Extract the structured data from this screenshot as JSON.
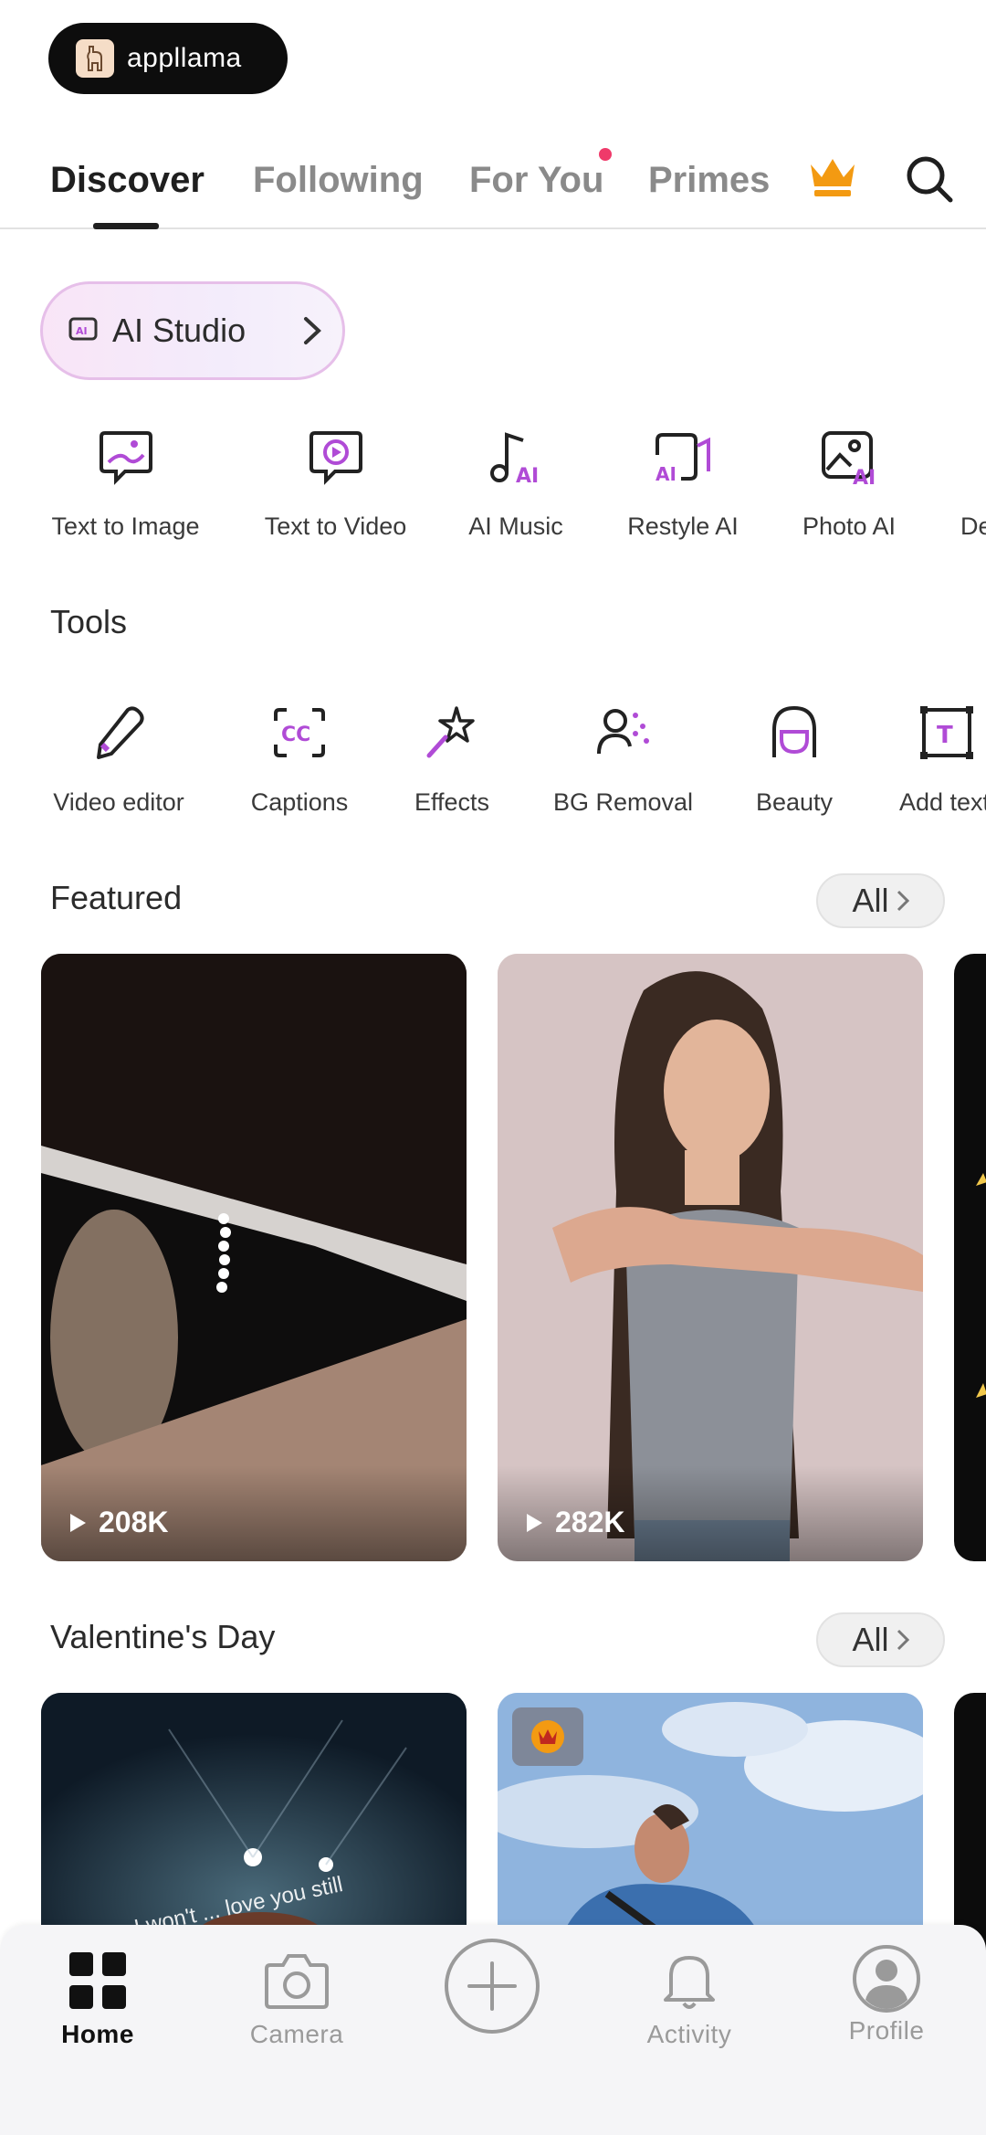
{
  "brand": {
    "name": "appllama",
    "logo_icon": "llama-logo-icon"
  },
  "tabs": [
    {
      "label": "Discover",
      "active": true
    },
    {
      "label": "Following",
      "active": false
    },
    {
      "label": "For You",
      "active": false,
      "has_dot": true
    },
    {
      "label": "Primes",
      "active": false
    }
  ],
  "header_icons": {
    "crown": "crown-icon",
    "search": "search-icon"
  },
  "ai_studio": {
    "label": "AI Studio",
    "icon": "ai-studio-icon"
  },
  "ai_tools": [
    {
      "label": "Text to Image",
      "icon": "text-to-image-icon"
    },
    {
      "label": "Text to Video",
      "icon": "text-to-video-icon"
    },
    {
      "label": "AI Music",
      "icon": "ai-music-icon"
    },
    {
      "label": "Restyle AI",
      "icon": "restyle-ai-icon"
    },
    {
      "label": "Photo AI",
      "icon": "photo-ai-icon"
    },
    {
      "label": "De",
      "icon": ""
    }
  ],
  "tools_section": {
    "title": "Tools"
  },
  "tools": [
    {
      "label": "Video editor",
      "icon": "pencil-icon"
    },
    {
      "label": "Captions",
      "icon": "captions-icon"
    },
    {
      "label": "Effects",
      "icon": "effects-wand-icon"
    },
    {
      "label": "BG Removal",
      "icon": "bg-removal-icon"
    },
    {
      "label": "Beauty",
      "icon": "beauty-icon"
    },
    {
      "label": "Add text",
      "icon": "add-text-icon"
    }
  ],
  "featured": {
    "title": "Featured",
    "all_label": "All",
    "cards": [
      {
        "views": "208K"
      },
      {
        "views": "282K"
      }
    ]
  },
  "valentines": {
    "title": "Valentine's Day",
    "all_label": "All",
    "overlay_text": "I won't ... love you still"
  },
  "bottom_nav": [
    {
      "label": "Home",
      "icon": "home-grid-icon",
      "active": true
    },
    {
      "label": "Camera",
      "icon": "camera-icon",
      "active": false
    },
    {
      "label": "",
      "icon": "add-circle-icon",
      "active": false
    },
    {
      "label": "Activity",
      "icon": "bell-icon",
      "active": false
    },
    {
      "label": "Profile",
      "icon": "profile-icon",
      "active": false
    }
  ],
  "colors": {
    "accent": "#b04bd6",
    "crown": "#f39a12",
    "dot": "#ef3a6a"
  }
}
